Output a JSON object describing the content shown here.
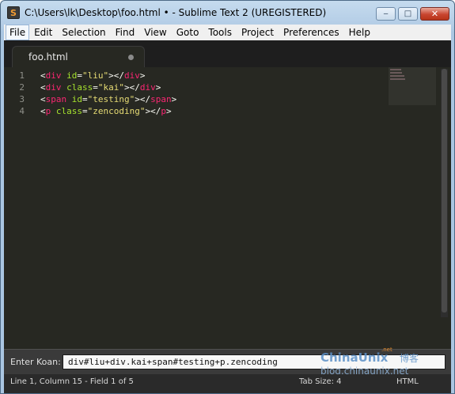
{
  "window": {
    "title": "C:\\Users\\lk\\Desktop\\foo.html • - Sublime Text 2 (UREGISTERED)",
    "minimize_glyph": "‒",
    "maximize_glyph": "□",
    "close_glyph": "✕"
  },
  "menu": [
    "File",
    "Edit",
    "Selection",
    "Find",
    "View",
    "Goto",
    "Tools",
    "Project",
    "Preferences",
    "Help"
  ],
  "tab": {
    "label": "foo.html",
    "modified": true
  },
  "editor": {
    "line_numbers": [
      "1",
      "2",
      "3",
      "4"
    ],
    "lines": [
      [
        [
          "<",
          "tok-punc"
        ],
        [
          "div",
          "tok-tag"
        ],
        [
          " ",
          "tok-punc"
        ],
        [
          "id",
          "tok-attr"
        ],
        [
          "=",
          "tok-punc"
        ],
        [
          "\"liu\"",
          "tok-str"
        ],
        [
          "></",
          "tok-punc"
        ],
        [
          "div",
          "tok-tag"
        ],
        [
          ">",
          "tok-punc"
        ]
      ],
      [
        [
          "<",
          "tok-punc"
        ],
        [
          "div",
          "tok-tag"
        ],
        [
          " ",
          "tok-punc"
        ],
        [
          "class",
          "tok-attr"
        ],
        [
          "=",
          "tok-punc"
        ],
        [
          "\"kai\"",
          "tok-str"
        ],
        [
          "></",
          "tok-punc"
        ],
        [
          "div",
          "tok-tag"
        ],
        [
          ">",
          "tok-punc"
        ]
      ],
      [
        [
          "<",
          "tok-punc"
        ],
        [
          "span",
          "tok-tag"
        ],
        [
          " ",
          "tok-punc"
        ],
        [
          "id",
          "tok-attr"
        ],
        [
          "=",
          "tok-punc"
        ],
        [
          "\"testing\"",
          "tok-str"
        ],
        [
          "></",
          "tok-punc"
        ],
        [
          "span",
          "tok-tag"
        ],
        [
          ">",
          "tok-punc"
        ]
      ],
      [
        [
          "<",
          "tok-punc"
        ],
        [
          "p",
          "tok-tag"
        ],
        [
          " ",
          "tok-punc"
        ],
        [
          "class",
          "tok-attr"
        ],
        [
          "=",
          "tok-punc"
        ],
        [
          "\"zencoding\"",
          "tok-str"
        ],
        [
          "></",
          "tok-punc"
        ],
        [
          "p",
          "tok-tag"
        ],
        [
          ">",
          "tok-punc"
        ]
      ]
    ]
  },
  "panel": {
    "label": "Enter Koan:",
    "value": "div#liu+div.kai+span#testing+p.zencoding"
  },
  "status": {
    "position": "Line 1, Column 15 - Field 1 of 5",
    "tab_size": "Tab Size: 4",
    "syntax": "HTML"
  },
  "watermark": {
    "brand": "ChinaUnix",
    "brand_suffix": "博客",
    "domain_badge": ".net",
    "url": "blog.chinaunix.net"
  },
  "colors": {
    "editor_bg": "#272822",
    "tag": "#f92672",
    "attribute": "#a6e22e",
    "string": "#e6db74",
    "gutter_text": "#8f908a",
    "watermark_blue": "#5b8fc7"
  }
}
